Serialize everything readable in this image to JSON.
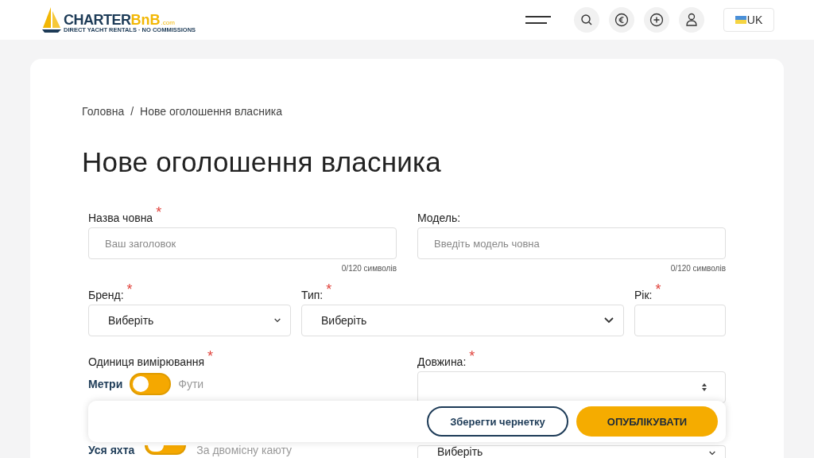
{
  "header": {
    "logo": {
      "main": "CHARTER",
      "accent": "BnB",
      "suffix": ".com",
      "tagline": "DIRECT YACHT RENTALS · NO COMMISSIONS"
    },
    "language": "UK"
  },
  "breadcrumb": {
    "items": [
      "Головна",
      "Нове оголошення власника"
    ],
    "separator": "/"
  },
  "title": "Нове оголошення власника",
  "row1": [
    {
      "label": "Назва човна",
      "required_mark": "*",
      "placeholder": "Ваш заголовок",
      "counter": "0/120 символів"
    },
    {
      "label": "Модель:",
      "placeholder": "Введіть модель човна",
      "counter": "0/120 символів"
    }
  ],
  "row2": [
    {
      "kind": "select",
      "label": "Бренд:",
      "required_mark": "*",
      "value": "Виберіть"
    },
    {
      "kind": "select",
      "label": "Тип:",
      "required_mark": "*",
      "value": "Виберіть"
    },
    {
      "kind": "input",
      "label": "Рік:",
      "required_mark": "*"
    }
  ],
  "unit": {
    "label": "Одиниця вимірювання",
    "required_mark": "*",
    "left": "Метри",
    "right": "Фути",
    "on": false
  },
  "length": {
    "label": "Довжина:",
    "required_mark": "*"
  },
  "rental": {
    "left": "Уся яхта",
    "right": "За двомісну каюту",
    "on": false
  },
  "bottom_select": {
    "value": "Виберіть"
  },
  "actions": {
    "draft": "Зберегти чернетку",
    "publish": "ОПУБЛІКУВАТИ"
  }
}
